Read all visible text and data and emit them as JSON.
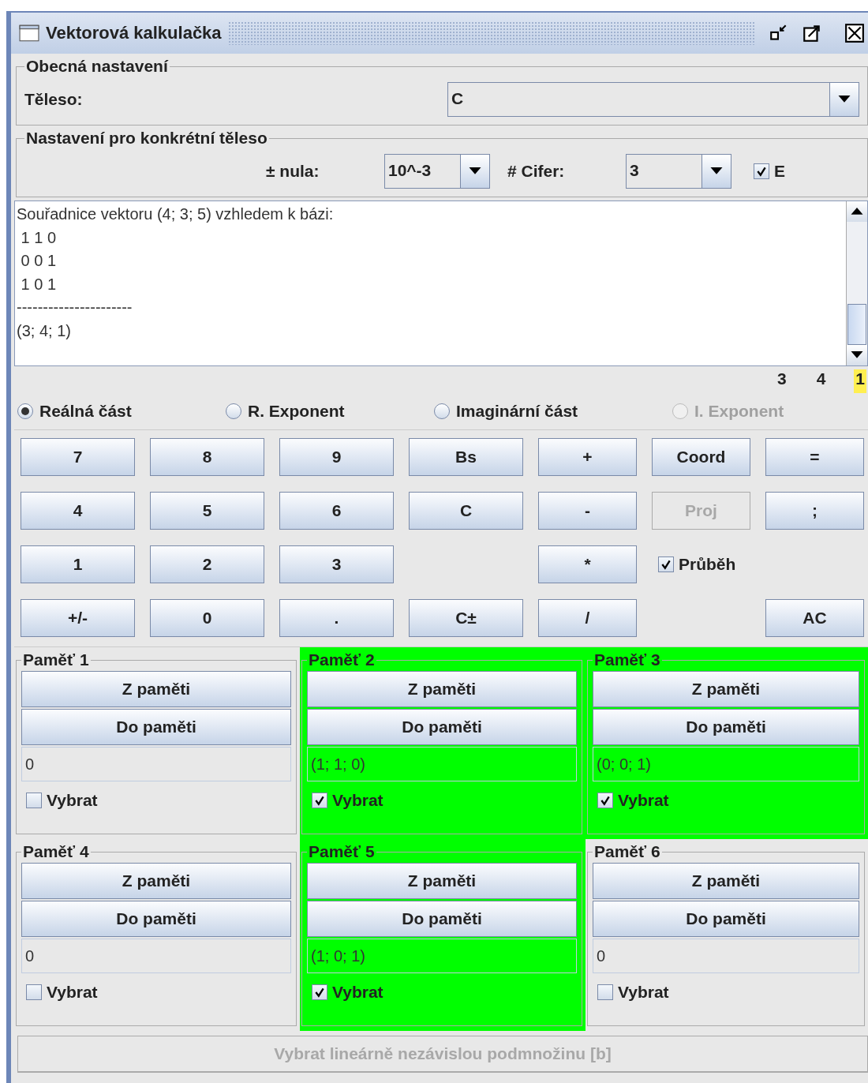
{
  "window": {
    "title": "Vektorová kalkulačka"
  },
  "general": {
    "legend": "Obecná nastavení",
    "label": "Těleso:",
    "value": "C"
  },
  "specific": {
    "legend": "Nastavení pro konkrétní těleso",
    "zero_label": "± nula:",
    "zero_value": "10^-3",
    "digits_label": "# Cifer:",
    "digits_value": "3",
    "e_checkbox": {
      "label": "E",
      "checked": true
    }
  },
  "output": {
    "lines": [
      "Souřadnice vektoru (4; 3; 5) vzhledem k bázi:",
      " 1 1 0",
      " 0 0 1",
      " 1 0 1",
      "----------------------",
      "(3; 4; 1)"
    ]
  },
  "indicators": [
    {
      "text": "3",
      "highlighted": false
    },
    {
      "text": "4",
      "highlighted": false
    },
    {
      "text": "1",
      "highlighted": true
    }
  ],
  "radios": [
    {
      "label": "Reálná část",
      "selected": true,
      "disabled": false
    },
    {
      "label": "R. Exponent",
      "selected": false,
      "disabled": false
    },
    {
      "label": "Imaginární část",
      "selected": false,
      "disabled": false
    },
    {
      "label": "I. Exponent",
      "selected": false,
      "disabled": true
    }
  ],
  "keypad": [
    {
      "kind": "button",
      "label": "7",
      "disabled": false
    },
    {
      "kind": "button",
      "label": "8",
      "disabled": false
    },
    {
      "kind": "button",
      "label": "9",
      "disabled": false
    },
    {
      "kind": "button",
      "label": "Bs",
      "disabled": false
    },
    {
      "kind": "button",
      "label": "+",
      "disabled": false
    },
    {
      "kind": "button",
      "label": "Coord",
      "disabled": false
    },
    {
      "kind": "button",
      "label": "=",
      "disabled": false
    },
    {
      "kind": "button",
      "label": "4",
      "disabled": false
    },
    {
      "kind": "button",
      "label": "5",
      "disabled": false
    },
    {
      "kind": "button",
      "label": "6",
      "disabled": false
    },
    {
      "kind": "button",
      "label": "C",
      "disabled": false
    },
    {
      "kind": "button",
      "label": "-",
      "disabled": false
    },
    {
      "kind": "button",
      "label": "Proj",
      "disabled": true
    },
    {
      "kind": "button",
      "label": ";",
      "disabled": false
    },
    {
      "kind": "button",
      "label": "1",
      "disabled": false
    },
    {
      "kind": "button",
      "label": "2",
      "disabled": false
    },
    {
      "kind": "button",
      "label": "3",
      "disabled": false
    },
    {
      "kind": "empty"
    },
    {
      "kind": "button",
      "label": "*",
      "disabled": false
    },
    {
      "kind": "checkbox",
      "label": "Průběh",
      "checked": true
    },
    {
      "kind": "empty"
    },
    {
      "kind": "button",
      "label": "+/-",
      "disabled": false
    },
    {
      "kind": "button",
      "label": "0",
      "disabled": false
    },
    {
      "kind": "button",
      "label": ".",
      "disabled": false
    },
    {
      "kind": "button",
      "label": "C±",
      "disabled": false
    },
    {
      "kind": "button",
      "label": "/",
      "disabled": false
    },
    {
      "kind": "empty"
    },
    {
      "kind": "button",
      "label": "AC",
      "disabled": false
    }
  ],
  "memories": [
    {
      "title": "Paměť 1",
      "load": "Z paměti",
      "store": "Do paměti",
      "value": "0",
      "checkbox": "Vybrat",
      "checked": false
    },
    {
      "title": "Paměť 2",
      "load": "Z paměti",
      "store": "Do paměti",
      "value": "(1; 1; 0)",
      "checkbox": "Vybrat",
      "checked": true
    },
    {
      "title": "Paměť 3",
      "load": "Z paměti",
      "store": "Do paměti",
      "value": "(0; 0; 1)",
      "checkbox": "Vybrat",
      "checked": true
    },
    {
      "title": "Paměť 4",
      "load": "Z paměti",
      "store": "Do paměti",
      "value": "0",
      "checkbox": "Vybrat",
      "checked": false
    },
    {
      "title": "Paměť 5",
      "load": "Z paměti",
      "store": "Do paměti",
      "value": "(1; 0; 1)",
      "checkbox": "Vybrat",
      "checked": true
    },
    {
      "title": "Paměť 6",
      "load": "Z paměti",
      "store": "Do paměti",
      "value": "0",
      "checkbox": "Vybrat",
      "checked": false
    }
  ],
  "bottom_button": {
    "label": "Vybrat lineárně nezávislou podmnožinu [b]",
    "disabled": true
  }
}
